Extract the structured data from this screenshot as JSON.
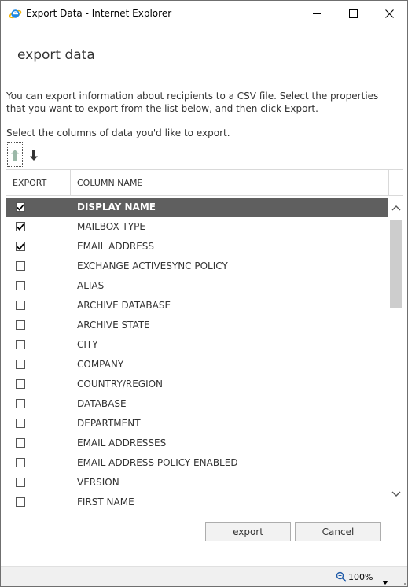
{
  "window": {
    "title": "Export Data - Internet Explorer",
    "icon": "internet-explorer-icon"
  },
  "page": {
    "title": "export data",
    "intro": "You can export information about recipients to a CSV file. Select the properties that you want to export from the list below, and then click Export.",
    "select_label": "Select the columns of data you'd like to export."
  },
  "grid": {
    "headers": {
      "export": "EXPORT",
      "column_name": "COLUMN NAME"
    },
    "rows": [
      {
        "label": "DISPLAY NAME",
        "checked": true,
        "selected": true
      },
      {
        "label": "MAILBOX TYPE",
        "checked": true,
        "selected": false
      },
      {
        "label": "EMAIL ADDRESS",
        "checked": true,
        "selected": false
      },
      {
        "label": "EXCHANGE ACTIVESYNC POLICY",
        "checked": false,
        "selected": false
      },
      {
        "label": "ALIAS",
        "checked": false,
        "selected": false
      },
      {
        "label": "ARCHIVE DATABASE",
        "checked": false,
        "selected": false
      },
      {
        "label": "ARCHIVE STATE",
        "checked": false,
        "selected": false
      },
      {
        "label": "CITY",
        "checked": false,
        "selected": false
      },
      {
        "label": "COMPANY",
        "checked": false,
        "selected": false
      },
      {
        "label": "COUNTRY/REGION",
        "checked": false,
        "selected": false
      },
      {
        "label": "DATABASE",
        "checked": false,
        "selected": false
      },
      {
        "label": "DEPARTMENT",
        "checked": false,
        "selected": false
      },
      {
        "label": "EMAIL ADDRESSES",
        "checked": false,
        "selected": false
      },
      {
        "label": "EMAIL ADDRESS POLICY ENABLED",
        "checked": false,
        "selected": false
      },
      {
        "label": "VERSION",
        "checked": false,
        "selected": false
      },
      {
        "label": "FIRST NAME",
        "checked": false,
        "selected": false
      }
    ]
  },
  "buttons": {
    "export": "export",
    "cancel": "Cancel"
  },
  "statusbar": {
    "zoom": "100%"
  },
  "colors": {
    "selected_row": "#5f5f5f",
    "ie_blue": "#1e88e5",
    "ie_gold": "#f4b400"
  }
}
